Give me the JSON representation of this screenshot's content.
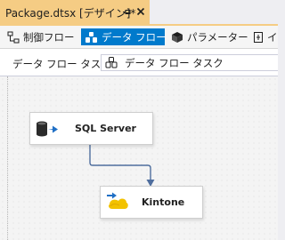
{
  "document_tab": {
    "title": "Package.dtsx [デザイン]*",
    "pin_icon": "pin-icon",
    "close_icon": "close-icon"
  },
  "designer_tabs": [
    {
      "label": "制御フロー",
      "icon": "control-flow-icon",
      "active": false
    },
    {
      "label": "データ フロー",
      "icon": "data-flow-icon",
      "active": true
    },
    {
      "label": "パラメーター",
      "icon": "parameters-icon",
      "active": false
    },
    {
      "label": "イ",
      "icon": "event-handlers-icon",
      "active": false
    }
  ],
  "task_bar": {
    "label": "データ フロー タスク:",
    "selected_task": "データ フロー タスク",
    "task_icon": "data-flow-task-icon"
  },
  "components": [
    {
      "label": "SQL Server",
      "icon": "database-source-icon"
    },
    {
      "label": "Kintone",
      "icon": "kintone-destination-icon"
    }
  ],
  "colors": {
    "active_tab": "#007ACC",
    "document_tab": "#F5CC84",
    "connector": "#4F6E9E"
  }
}
